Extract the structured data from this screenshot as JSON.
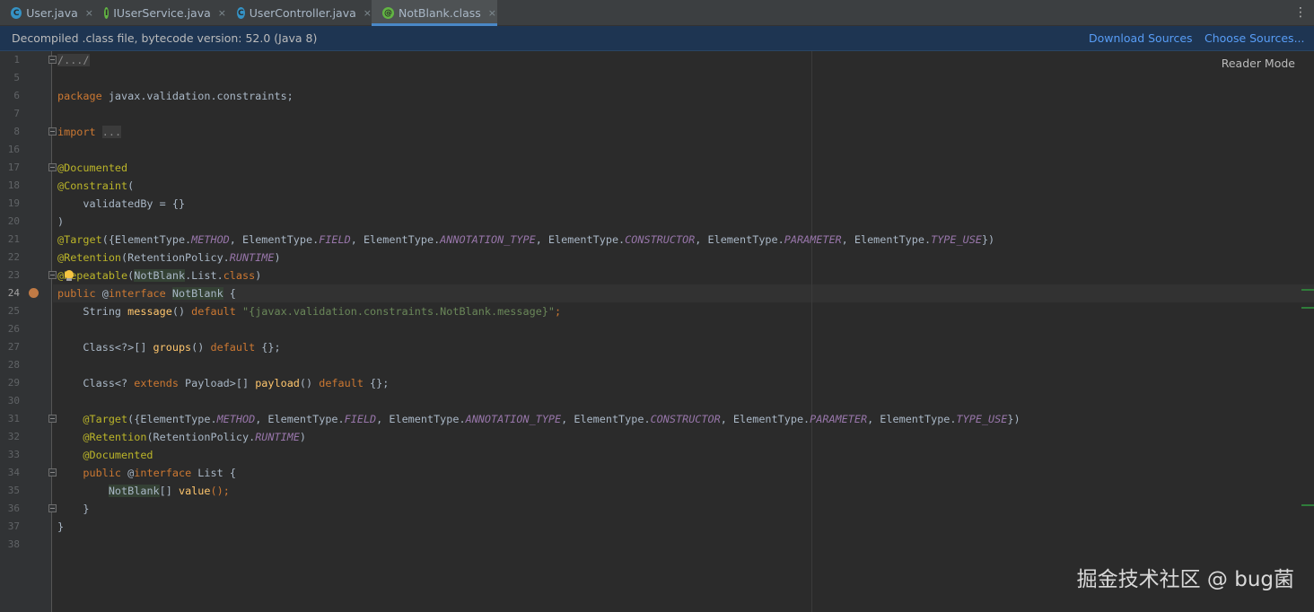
{
  "tabs": [
    {
      "label": "User.java",
      "icon": "class-icon",
      "icon_glyph": "C"
    },
    {
      "label": "IUserService.java",
      "icon": "interface-icon",
      "icon_glyph": "I"
    },
    {
      "label": "UserController.java",
      "icon": "class-icon",
      "icon_glyph": "C"
    },
    {
      "label": "NotBlank.class",
      "icon": "annotation-icon",
      "icon_glyph": "@",
      "active": true
    }
  ],
  "tab_close_glyph": "×",
  "menu_glyph": "⋮",
  "notice": {
    "text": "Decompiled .class file, bytecode version: 52.0 (Java 8)",
    "download_sources": "Download Sources",
    "choose_sources": "Choose Sources..."
  },
  "editor": {
    "reader_mode": "Reader Mode",
    "current_line": "24",
    "line_numbers": [
      "1",
      "5",
      "6",
      "7",
      "8",
      "16",
      "17",
      "18",
      "19",
      "20",
      "21",
      "22",
      "23",
      "24",
      "25",
      "26",
      "27",
      "28",
      "29",
      "30",
      "31",
      "32",
      "33",
      "34",
      "35",
      "36",
      "37",
      "38"
    ]
  },
  "code": {
    "l1": "/.../",
    "l6_kw": "package",
    "l6_rest": " javax.validation.constraints;",
    "l8_kw": "import",
    "l8_fold": "...",
    "l17": "@Documented",
    "l18_an": "@Constraint",
    "l18_rest": "(",
    "l19": "    validatedBy = {}",
    "l20": ")",
    "l21_an": "@Target",
    "l21_a": "({ElementType.",
    "l21_m": "METHOD",
    "l21_b": ", ElementType.",
    "l21_f": "FIELD",
    "l21_c": ", ElementType.",
    "l21_at": "ANNOTATION_TYPE",
    "l21_d": ", ElementType.",
    "l21_co": "CONSTRUCTOR",
    "l21_e": ", ElementType.",
    "l21_p": "PARAMETER",
    "l21_g": ", ElementType.",
    "l21_t": "TYPE_USE",
    "l21_end": "})",
    "l22_an": "@Retention",
    "l22_a": "(RetentionPolicy.",
    "l22_r": "RUNTIME",
    "l22_end": ")",
    "l23_an": "@Repeatable",
    "l23_a": "(",
    "l23_nb": "NotBlank",
    "l23_b": ".List.",
    "l23_kw": "class",
    "l23_end": ")",
    "l24_kw": "public",
    "l24_b": " @",
    "l24_kw2": "interface",
    "l24_sp": " ",
    "l24_name": "NotBlank",
    "l24_end": " {",
    "l25_a": "    String ",
    "l25_fn": "message",
    "l25_b": "() ",
    "l25_kw": "default",
    "l25_sp": " ",
    "l25_st": "\"{javax.validation.constraints.NotBlank.message}\"",
    "l25_end": ";",
    "l27_a": "    Class<?>[] ",
    "l27_fn": "groups",
    "l27_b": "() ",
    "l27_kw": "default",
    "l27_end": " {};",
    "l29_a": "    Class<? ",
    "l29_kw": "extends",
    "l29_b": " Payload>[] ",
    "l29_fn": "payload",
    "l29_c": "() ",
    "l29_kw2": "default",
    "l29_end": " {};",
    "l31_ind": "    ",
    "l32_ind": "    ",
    "l32_an": "@Retention",
    "l32_a": "(RetentionPolicy.",
    "l32_r": "RUNTIME",
    "l32_end": ")",
    "l33": "    @Documented",
    "l34_ind": "    ",
    "l34_kw": "public",
    "l34_b": " @",
    "l34_kw2": "interface",
    "l34_sp": " ",
    "l34_name": "List",
    "l34_end": " {",
    "l35_ind": "        ",
    "l35_nb": "NotBlank",
    "l35_a": "[] ",
    "l35_fn": "value",
    "l35_end": "();",
    "l36": "    }",
    "l37": "}"
  },
  "watermark": "掘金技术社区 @ bug菌"
}
